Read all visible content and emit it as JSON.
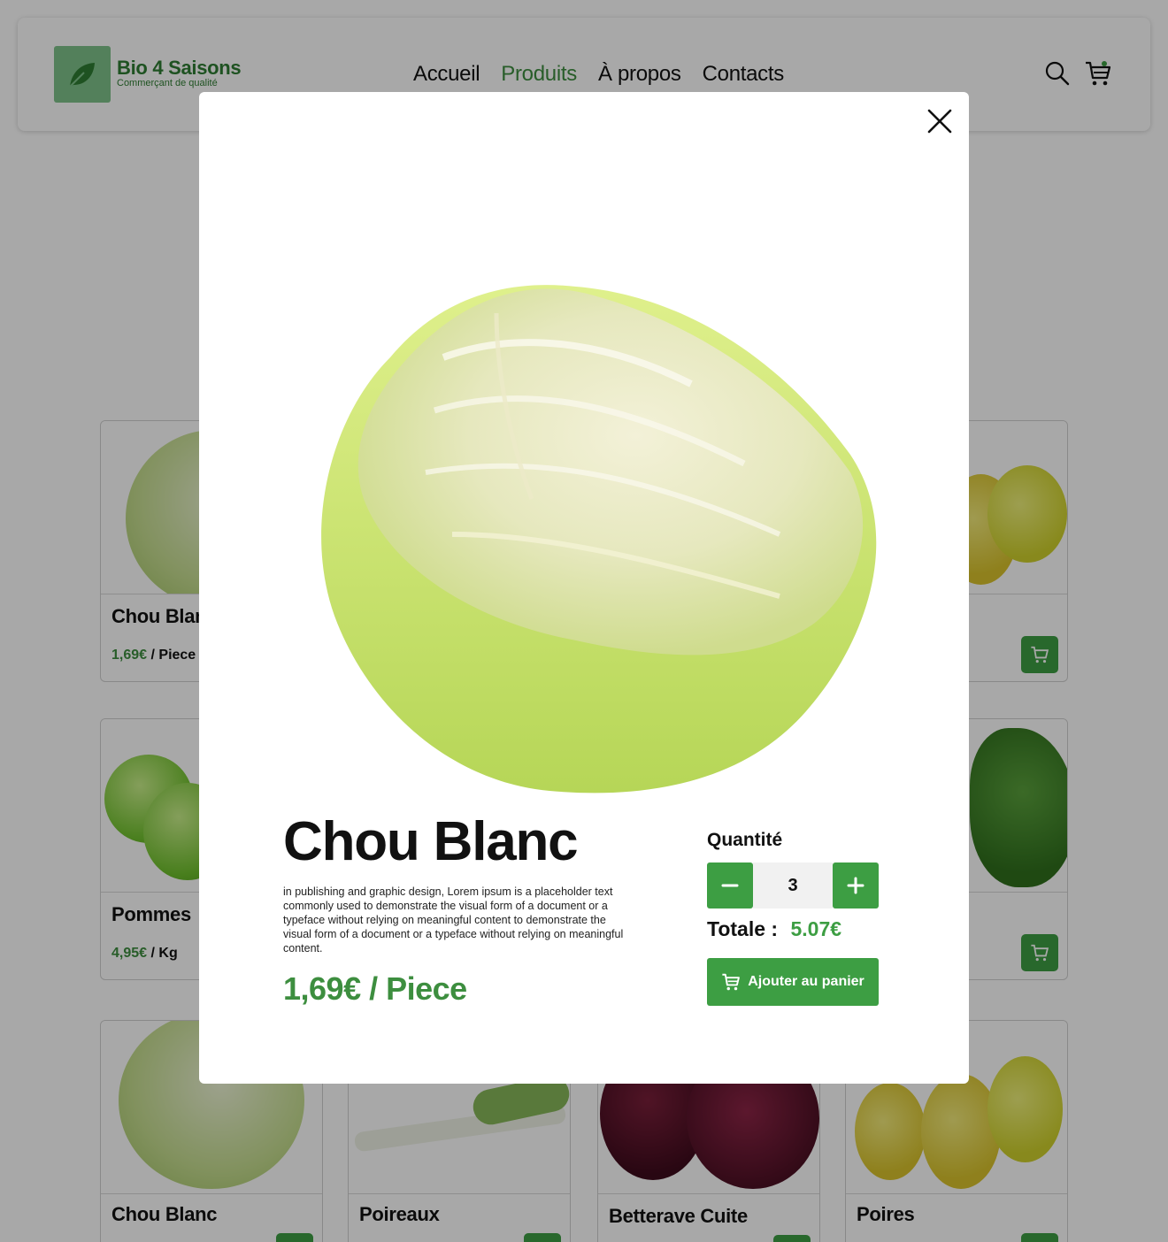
{
  "brand": {
    "name": "Bio 4 Saisons",
    "tagline": "Commerçant de qualité"
  },
  "nav": [
    {
      "label": "Accueil",
      "active": false
    },
    {
      "label": "Produits",
      "active": true
    },
    {
      "label": "À propos",
      "active": false
    },
    {
      "label": "Contacts",
      "active": false
    }
  ],
  "header_icons": [
    "search-icon",
    "cart-icon"
  ],
  "products": [
    {
      "name": "Chou Blanc",
      "price": "1,69€",
      "unit": "/ Piece"
    },
    {
      "name": "Pommes",
      "price": "4,95€",
      "unit": "/ Kg"
    },
    {
      "name": "Chou Blanc"
    },
    {
      "name": "Poireaux"
    },
    {
      "name": "Betterave Cuite"
    },
    {
      "name": "Poires"
    }
  ],
  "modal": {
    "title": "Chou Blanc",
    "description": "in publishing and graphic design, Lorem ipsum is a placeholder text commonly used to demonstrate the visual form of a document or a typeface without relying on meaningful content to demonstrate the visual form of a document or a typeface without relying on meaningful content.",
    "price": "1,69€",
    "unit": "/ Piece",
    "quantity_label": "Quantité",
    "quantity": "3",
    "total_label": "Totale :",
    "total": "5.07€",
    "add_to_cart": "Ajouter au panier"
  },
  "colors": {
    "accent": "#3d9e43",
    "accent_text": "#3d8e3f",
    "overlay": "rgba(0,0,0,0.34)"
  }
}
